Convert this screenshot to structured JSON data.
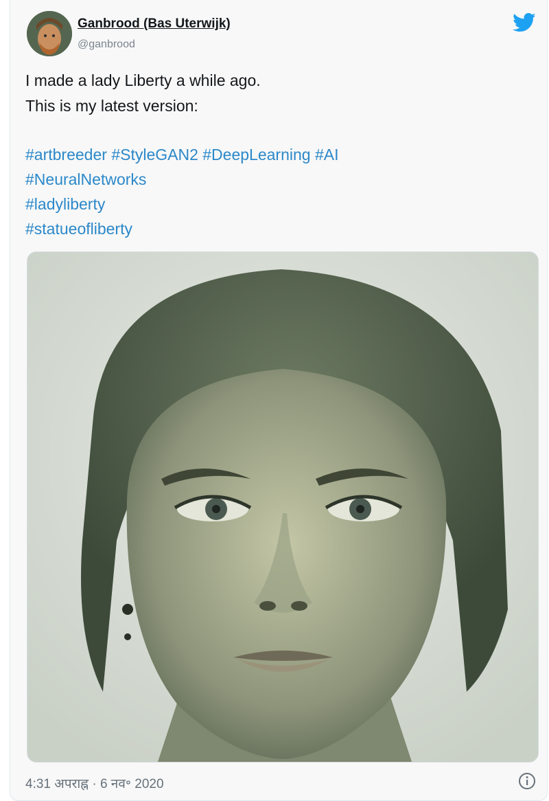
{
  "tweet": {
    "display_name": "Ganbrood (Bas Uterwijk)",
    "handle": "@ganbrood",
    "text_lines": [
      "I made a lady Liberty a while ago.",
      "This is my latest version:"
    ],
    "hashtag_lines": [
      [
        "#artbreeder",
        "#StyleGAN2",
        "#DeepLearning",
        "#AI"
      ],
      [
        "#NeuralNetworks"
      ],
      [
        "#ladyliberty"
      ],
      [
        "#statueofliberty"
      ]
    ],
    "timestamp": "4:31 अपराह्न · 6 नव॰ 2020",
    "icons": {
      "brand": "twitter-bird-icon",
      "info": "info-icon"
    },
    "colors": {
      "hashtag": "#2b88c9",
      "twitter_blue": "#1da1f2"
    }
  }
}
